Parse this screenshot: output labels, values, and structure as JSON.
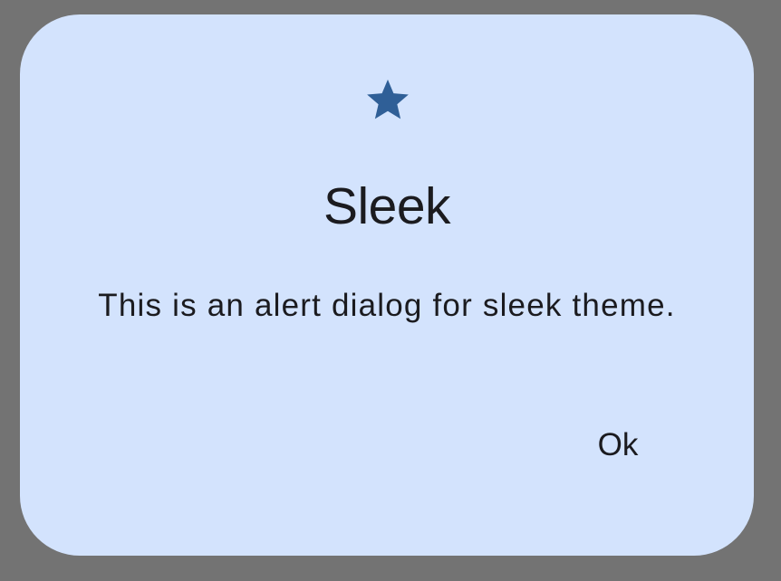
{
  "dialog": {
    "icon": "star-icon",
    "title": "Sleek",
    "message": "This is an alert dialog for sleek theme.",
    "ok_label": "Ok"
  },
  "colors": {
    "scrim": "#737373",
    "surface": "#d3e3fd",
    "icon": "#2f5f97",
    "text": "#1b1b1f"
  }
}
